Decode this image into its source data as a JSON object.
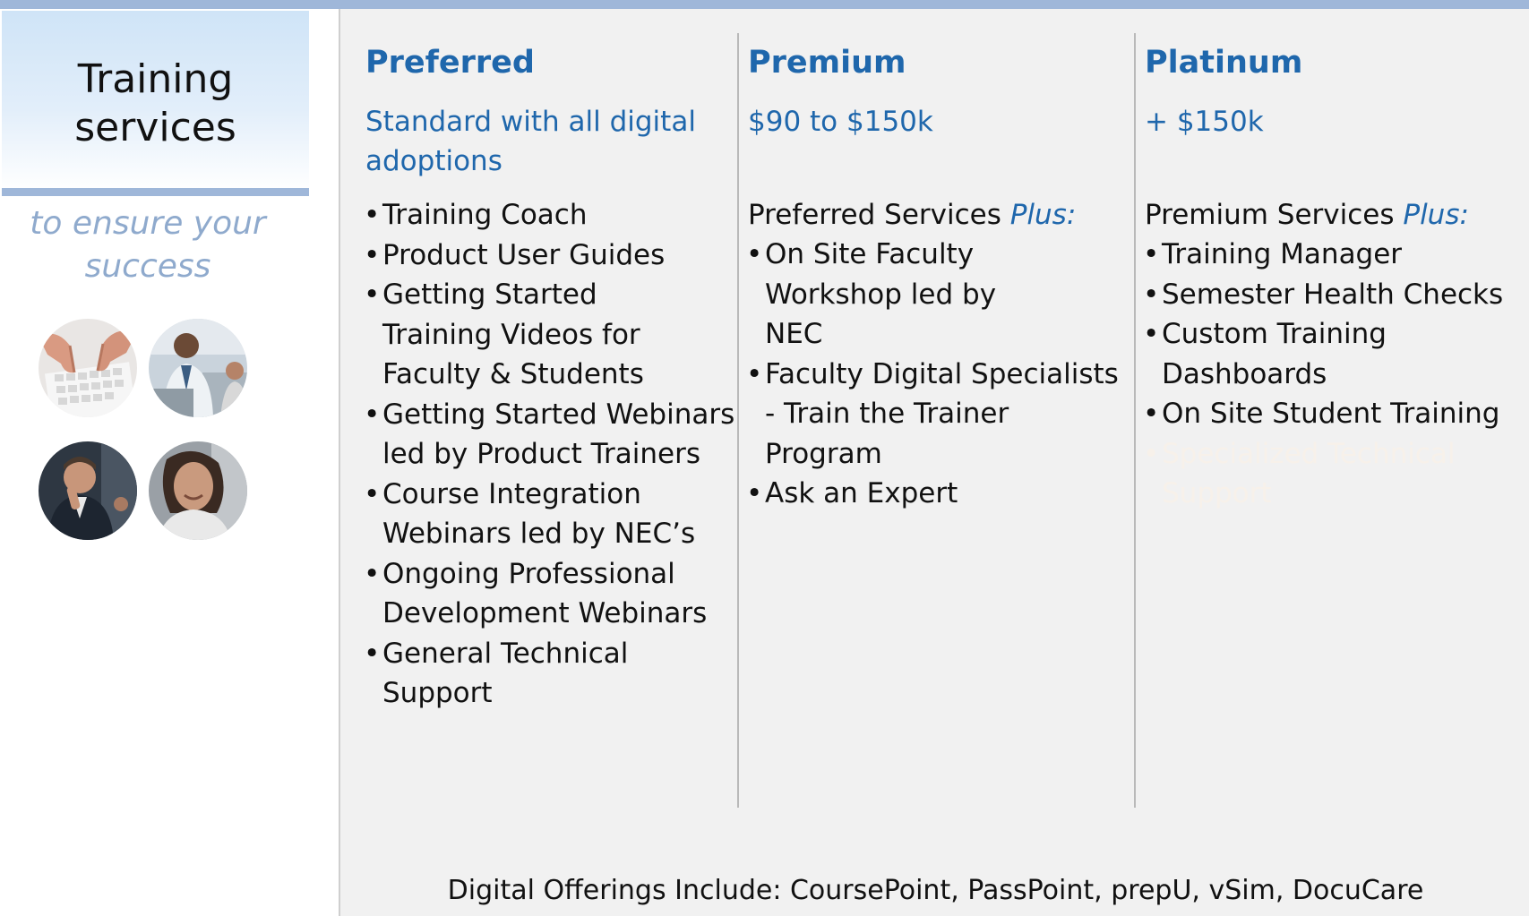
{
  "sidebar": {
    "title_line1": "Training",
    "title_line2": "services",
    "tagline": "to ensure your success",
    "photos": [
      "keyboard-hands-photo",
      "meeting-group-photo",
      "thinking-man-photo",
      "smiling-woman-photo"
    ]
  },
  "tiers": [
    {
      "name": "Preferred",
      "price": "Standard with all digital adoptions",
      "intro": "",
      "intro_plus": "",
      "features": [
        "Training Coach",
        "Product User Guides",
        "Getting Started Training Videos for Faculty & Students",
        "Getting Started Webinars led by Product Trainers",
        "Course Integration Webinars led by NEC’s",
        "Ongoing Professional Development Webinars",
        "General Technical Support"
      ]
    },
    {
      "name": "Premium",
      "price": "$90 to $150k",
      "intro": "Preferred Services ",
      "intro_plus": "Plus:",
      "features": [
        "On Site Faculty Workshop led by NEC",
        "Faculty Digital Specialists - Train the Trainer Program",
        "Ask an Expert"
      ]
    },
    {
      "name": "Platinum",
      "price": "+ $150k",
      "intro": "Premium Services ",
      "intro_plus": "Plus:",
      "features": [
        "Training Manager",
        "Semester Health Checks",
        "Custom Training Dashboards",
        "On Site Student Training"
      ],
      "faded_feature": "Specialized Technical Support"
    }
  ],
  "footer": {
    "text": "Digital Offerings Include: CoursePoint, PassPoint, prepU, vSim, DocuCare"
  },
  "colors": {
    "accent_blue": "#1f67ac",
    "bar_blue": "#9fb7d9",
    "tagline_blue": "#8faacd",
    "panel_gray": "#f1f1f1"
  }
}
